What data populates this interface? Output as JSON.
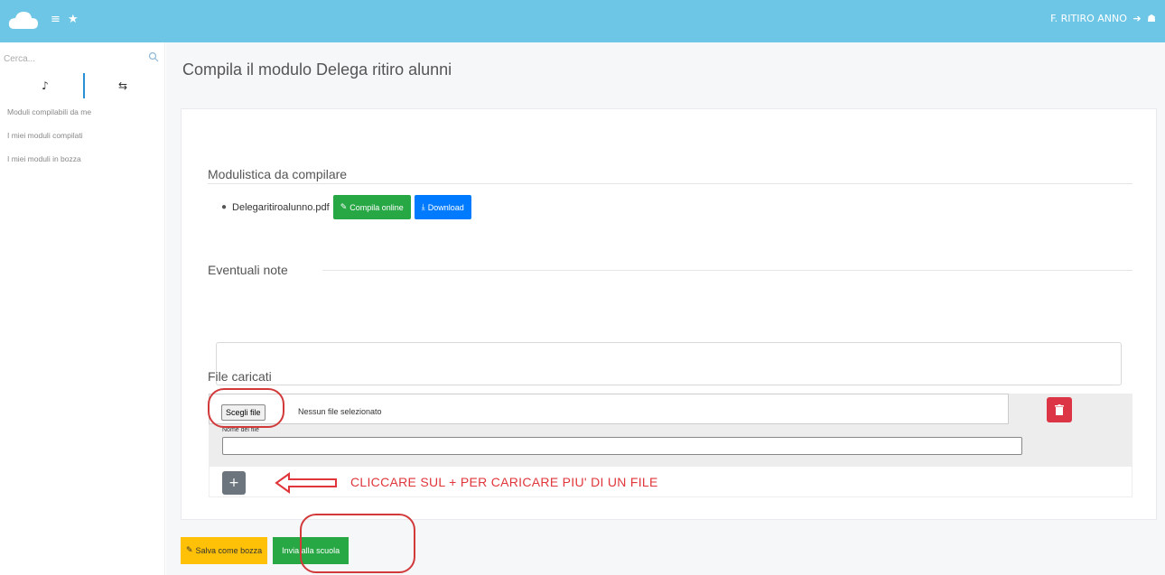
{
  "header": {
    "menu_icons": "≡ ★",
    "user_label": "F. RITIRO ANNO",
    "logout_icon": "logout-icon",
    "user_icon": "user-icon",
    "brand_color": "#6ec6e6"
  },
  "sidebar": {
    "search_placeholder": "Cerca...",
    "tabs": [
      {
        "icon": "♪",
        "name": "music-note-icon"
      },
      {
        "icon": "⇆",
        "name": "swap-icon"
      }
    ],
    "items": [
      {
        "label": "Moduli compilabili da me"
      },
      {
        "label": "I miei moduli compilati"
      },
      {
        "label": "I miei moduli in bozza"
      }
    ]
  },
  "main": {
    "title": "Compila il modulo Delega ritiro alunni",
    "modulistica": {
      "title": "Modulistica da compilare",
      "file_name": "Delegaritiroalunno.pdf",
      "compile_label": "Compila online",
      "download_label": "Download"
    },
    "notes": {
      "title": "Eventuali note",
      "value": ""
    },
    "uploads": {
      "title": "File caricati",
      "choose_label": "Scegli file",
      "no_file_label": "Nessun file selezionato",
      "name_label": "Nome del file",
      "name_value": "",
      "add_label": "+",
      "annotation": "CLICCARE SUL + PER CARICARE PIU' DI UN FILE"
    },
    "footer": {
      "draft_label": "Salva come bozza",
      "submit_label": "Invia alla scuola"
    }
  },
  "colors": {
    "green": "#28a745",
    "blue": "#007bff",
    "red": "#dc3545",
    "yellow": "#ffc107",
    "annotation_red": "#e0363b"
  }
}
